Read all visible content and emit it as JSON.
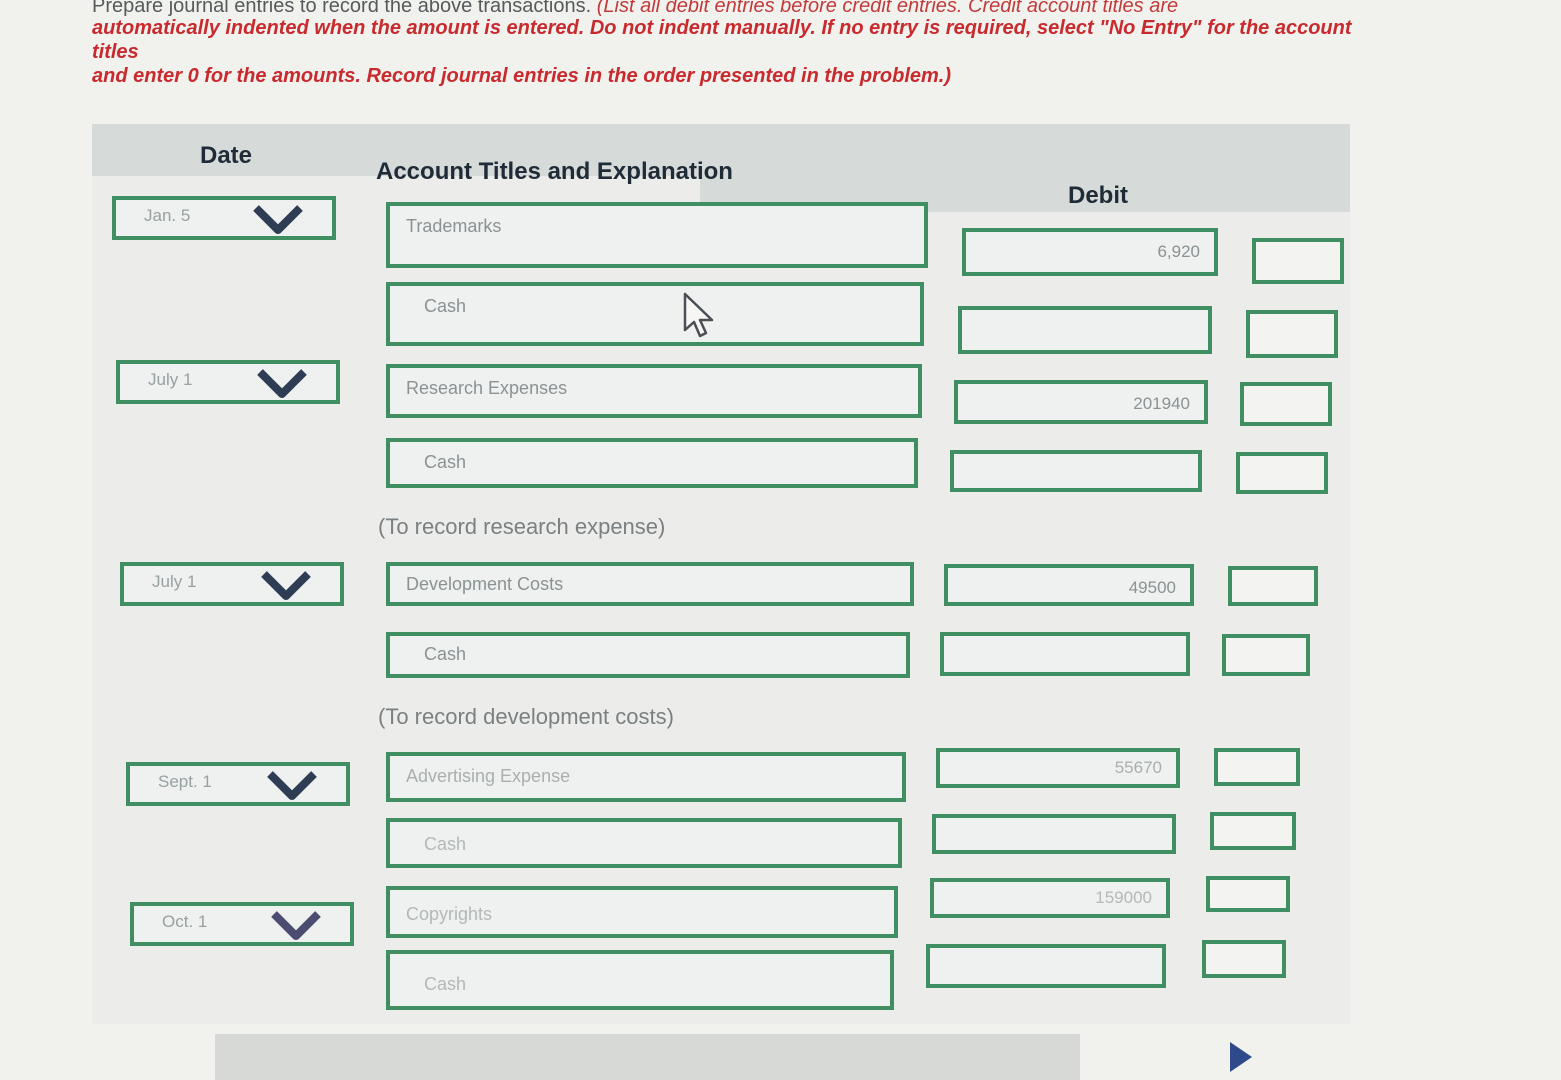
{
  "instructions": {
    "line1_prefix": "Prepare journal entries to record the above transactions.",
    "line1_red": " (List all debit entries before credit entries. Credit account titles are",
    "line2": "automatically indented when the amount is entered. Do not indent manually. If no entry is required, select \"No Entry\" for the account titles",
    "line3": "and enter 0 for the amounts. Record journal entries in the order presented in the problem.)"
  },
  "table": {
    "headers": {
      "date": "Date",
      "account": "Account Titles and Explanation",
      "debit": "Debit"
    },
    "entries": [
      {
        "date": "Jan. 5",
        "rows": [
          {
            "account": "Trademarks",
            "debit": "6,920",
            "credit": ""
          },
          {
            "account": "Cash",
            "debit": "",
            "credit": ""
          }
        ],
        "note": ""
      },
      {
        "date": "July 1",
        "rows": [
          {
            "account": "Research Expenses",
            "debit": "201940",
            "credit": ""
          },
          {
            "account": "Cash",
            "debit": "",
            "credit": ""
          }
        ],
        "note": "(To record research expense)"
      },
      {
        "date": "July 1",
        "rows": [
          {
            "account": "Development Costs",
            "debit": "49500",
            "credit": ""
          },
          {
            "account": "Cash",
            "debit": "",
            "credit": ""
          }
        ],
        "note": "(To record development costs)"
      },
      {
        "date": "Sept. 1",
        "rows": [
          {
            "account": "Advertising Expense",
            "debit": "55670",
            "credit": ""
          },
          {
            "account": "Cash",
            "debit": "",
            "credit": ""
          }
        ],
        "note": ""
      },
      {
        "date": "Oct. 1",
        "rows": [
          {
            "account": "Copyrights",
            "debit": "159000",
            "credit": ""
          },
          {
            "account": "Cash",
            "debit": "",
            "credit": ""
          }
        ],
        "note": ""
      }
    ]
  },
  "icons": {
    "dropdown": "chevron-down-icon",
    "cursor": "mouse-pointer-icon",
    "next": "next-arrow-icon"
  },
  "colors": {
    "field_border": "#3f8f63",
    "instruction_red": "#c82a2e",
    "chevron": "#2e3d54"
  }
}
